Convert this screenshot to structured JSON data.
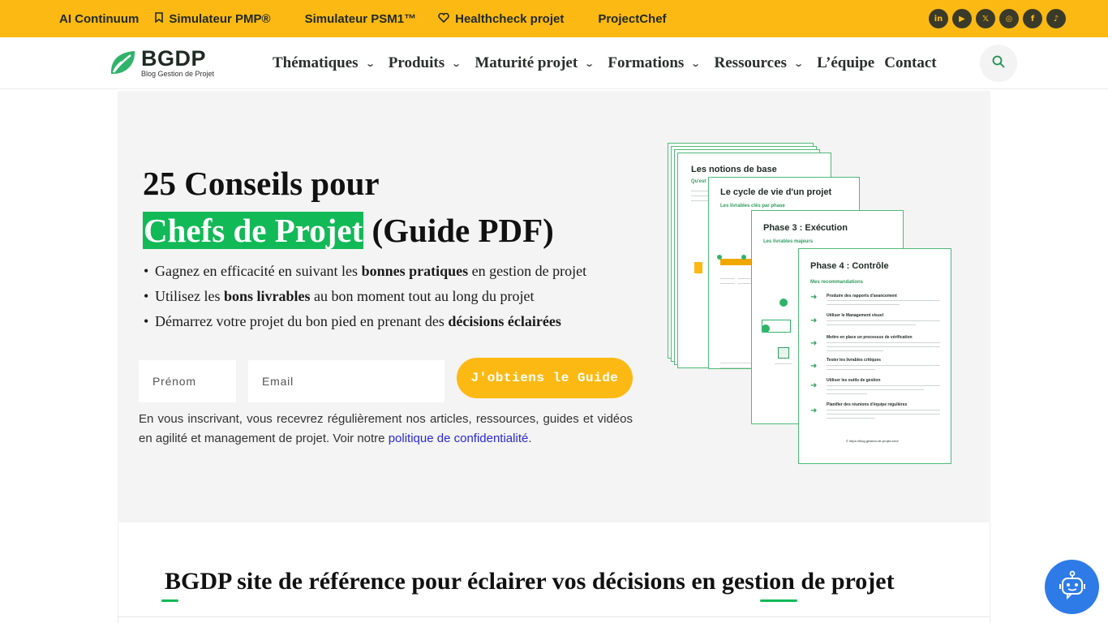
{
  "topbar": {
    "links": [
      {
        "label": "AI Continuum",
        "icon": ""
      },
      {
        "label": "Simulateur PMP®",
        "icon": "bookmark-icon"
      },
      {
        "label": "Simulateur PSM1™",
        "icon": ""
      },
      {
        "label": "Healthcheck projet",
        "icon": "heart-icon"
      },
      {
        "label": "ProjectChef",
        "icon": ""
      }
    ],
    "socials": [
      "linkedin-icon",
      "youtube-icon",
      "x-icon",
      "instagram-icon",
      "facebook-icon",
      "tiktok-icon"
    ],
    "social_glyphs": [
      "in",
      "▶",
      "𝕏",
      "◎",
      "f",
      "♪"
    ]
  },
  "header": {
    "logo_title": "BGDP",
    "logo_subtitle": "Blog Gestion de Projet",
    "nav": [
      {
        "label": "Thématiques",
        "has_dropdown": true
      },
      {
        "label": "Produits",
        "has_dropdown": true
      },
      {
        "label": "Maturité projet",
        "has_dropdown": true
      },
      {
        "label": "Formations",
        "has_dropdown": true
      },
      {
        "label": "Ressources",
        "has_dropdown": true
      },
      {
        "label": "L’équipe",
        "has_dropdown": false
      },
      {
        "label": "Contact",
        "has_dropdown": false
      }
    ],
    "chevron": "⌄"
  },
  "hero": {
    "title_line1": "25 Conseils pour",
    "title_highlight": "Chefs de Projet",
    "title_rest": " (Guide PDF)",
    "bullets": [
      {
        "pre": "Gagnez en efficacité en suivant les ",
        "bold": "bonnes pratiques",
        "post": " en gestion de projet"
      },
      {
        "pre": "Utilisez les ",
        "bold": "bons livrables",
        "post": " au bon moment tout au long du projet"
      },
      {
        "pre": "Démarrez votre projet du bon pied en prenant des ",
        "bold": "décisions éclairées",
        "post": ""
      }
    ],
    "form": {
      "firstname_placeholder": "Prénom",
      "email_placeholder": "Email",
      "submit_label": "J'obtiens le Guide"
    },
    "consent_text": "En vous inscrivant, vous recevrez régulièrement nos articles, ressources, guides et vidéos en agilité et management de projet. Voir notre ",
    "consent_link": "politique de confidentialité",
    "consent_end": ".",
    "pdf_pages": [
      {
        "title": "Les notions de base",
        "subtitle": "Qu'est"
      },
      {
        "title": "Le cycle de vie d'un projet",
        "subtitle": "Les livrables clés par phase"
      },
      {
        "title": "Phase 3 : Exécution",
        "subtitle": "Les livrables majeurs"
      },
      {
        "title": "Phase 4 : Contrôle",
        "subtitle": "Mes recommandations"
      }
    ],
    "page4_items": [
      "Produire des rapports d'avancement",
      "Utiliser le Management visuel",
      "Mettre en place un processus de vérification",
      "Tester les livrables critiques",
      "Utiliser les outils de gestion",
      "Planifier des réunions d'équipe régulières"
    ],
    "page4_footer": "© https://blog-gestion-de-projet.com/"
  },
  "bottom": {
    "title": "BGDP site de référence pour éclairer vos décisions en gestion de projet"
  },
  "colors": {
    "accent_yellow": "#fdb913",
    "accent_green": "#12b957",
    "chatbot_blue": "#2e7be8"
  }
}
